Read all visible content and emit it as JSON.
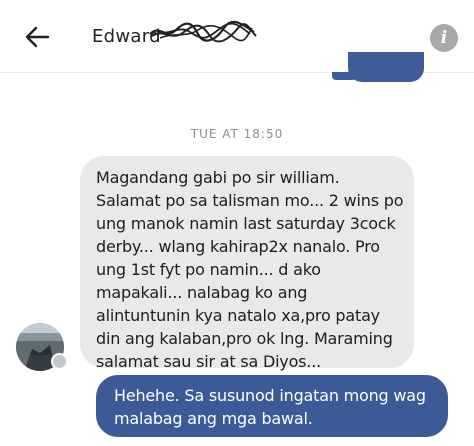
{
  "header": {
    "contact_name": "Edward",
    "back_icon": "arrow-left-icon",
    "info_icon": "info-icon",
    "info_glyph": "i"
  },
  "thread": {
    "timestamp": "TUE AT 18:50",
    "incoming_lines": [
      "Magandang gabi po sir william.",
      "Salamat po sa talisman mo... 2 wins po",
      "ung manok namin last saturday 3cock",
      "derby... wlang kahirap2x nanalo. Pro",
      "ung 1st fyt po namin... d ako",
      "mapakali... nalabag ko ang",
      "alintuntunin kya natalo xa,pro patay",
      "din ang kalaban,pro ok lng. Maraming",
      "salamat sau sir at sa Diyos..."
    ],
    "outgoing_lines": [
      "Hehehe. Sa susunod ingatan mong wag",
      "malabag ang mga bawal."
    ]
  },
  "colors": {
    "outgoing_bubble": "#3d5a98",
    "incoming_bubble": "#e9e9e9",
    "timestamp_text": "#8f8f8f"
  }
}
